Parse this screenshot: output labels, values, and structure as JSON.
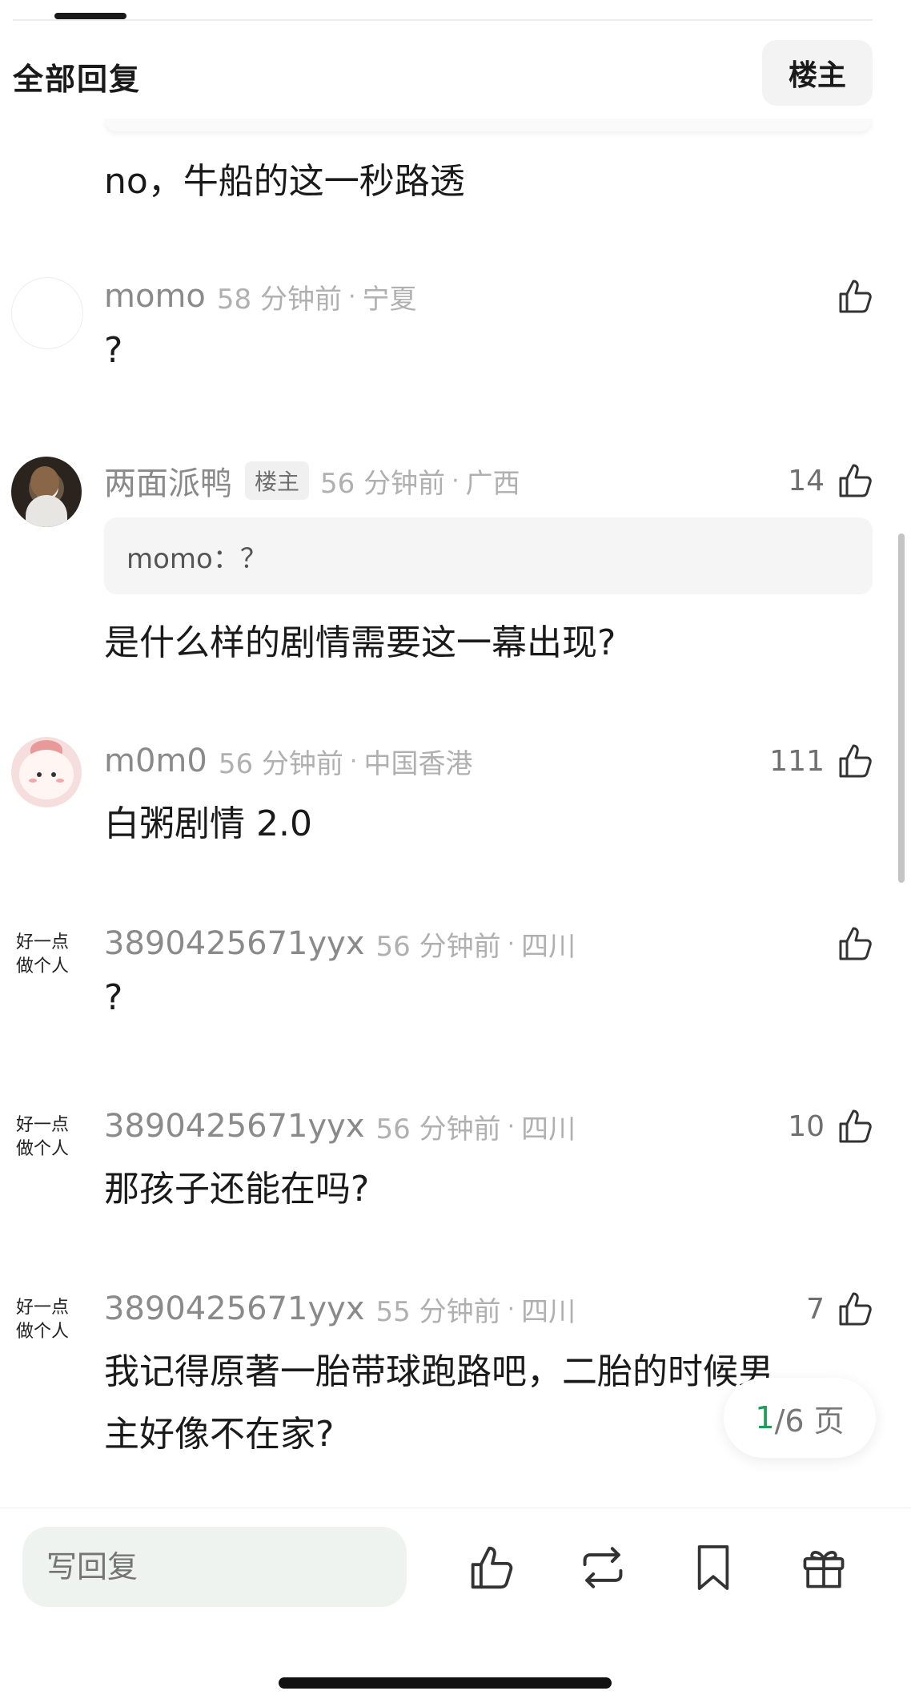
{
  "header": {
    "title": "全部回复",
    "op_filter_label": "楼主"
  },
  "truncated_comment": {
    "text": "no，牛船的这一秒路透"
  },
  "comments": [
    {
      "username": "momo",
      "op_badge": "",
      "time": "58 分钟前",
      "separator": "·",
      "location": "宁夏",
      "likes": "",
      "quote": "",
      "text": "?"
    },
    {
      "username": "两面派鸭",
      "op_badge": "楼主",
      "time": "56 分钟前",
      "separator": "·",
      "location": "广西",
      "likes": "14",
      "quote": "momo：？",
      "text": "是什么样的剧情需要这一幕出现?"
    },
    {
      "username": "m0m0",
      "op_badge": "",
      "time": "56 分钟前",
      "separator": "·",
      "location": "中国香港",
      "likes": "111",
      "quote": "",
      "text": "白粥剧情 2.0"
    },
    {
      "username": "3890425671yyx",
      "op_badge": "",
      "time": "56 分钟前",
      "separator": "·",
      "location": "四川",
      "likes": "",
      "quote": "",
      "text": "?",
      "avatar_text": [
        "好一点",
        "做个人"
      ]
    },
    {
      "username": "3890425671yyx",
      "op_badge": "",
      "time": "56 分钟前",
      "separator": "·",
      "location": "四川",
      "likes": "10",
      "quote": "",
      "text": "那孩子还能在吗?",
      "avatar_text": [
        "好一点",
        "做个人"
      ]
    },
    {
      "username": "3890425671yyx",
      "op_badge": "",
      "time": "55 分钟前",
      "separator": "·",
      "location": "四川",
      "likes": "7",
      "quote": "",
      "text_line1": "我记得原著一胎带球跑路吧，二胎的时候男",
      "text_line2": "主好像不在家?",
      "avatar_text": [
        "好一点",
        "做个人"
      ]
    }
  ],
  "pagination": {
    "current": "1",
    "total_text": "/6 页"
  },
  "bottom_bar": {
    "reply_placeholder": "写回复",
    "icons": [
      "like-icon",
      "repost-icon",
      "bookmark-icon",
      "gift-icon"
    ]
  },
  "colors": {
    "accent_green": "#1f9d57",
    "muted_gray": "#b0b0b0"
  }
}
